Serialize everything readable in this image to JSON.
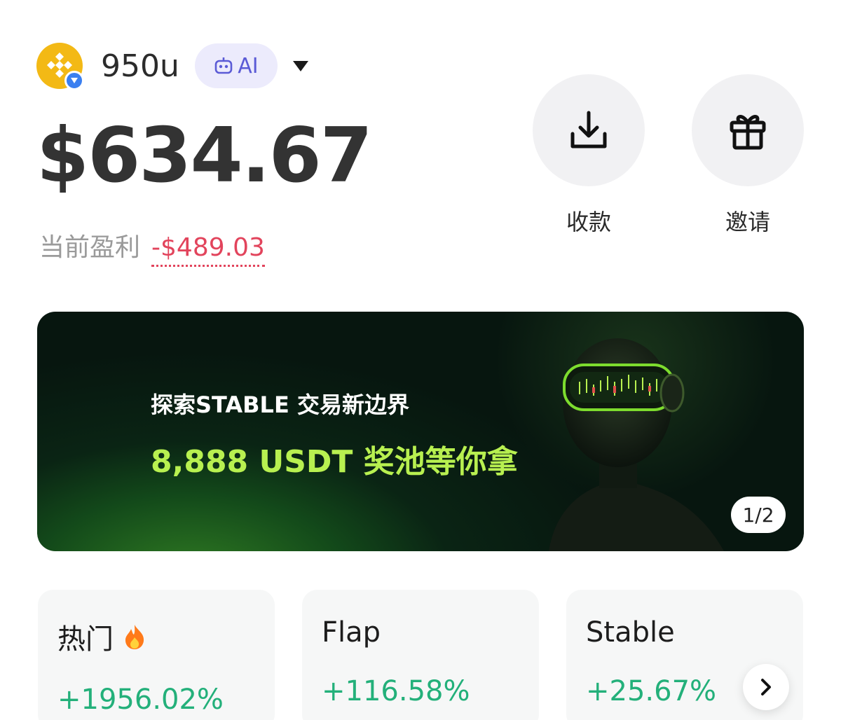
{
  "header": {
    "account_name": "950u",
    "ai_label": "AI"
  },
  "balance": {
    "amount": "$634.67",
    "pnl_label": "当前盈利",
    "pnl_value": "-$489.03"
  },
  "actions": [
    {
      "label": "收款",
      "icon": "download-icon"
    },
    {
      "label": "邀请",
      "icon": "gift-icon"
    }
  ],
  "banner": {
    "line1": "探索STABLE 交易新边界",
    "line2": "8,888 USDT 奖池等你拿",
    "pager": "1/2"
  },
  "cards": [
    {
      "title": "热门",
      "change": "+1956.02%",
      "icon": "fire-icon"
    },
    {
      "title": "Flap",
      "change": "+116.58%"
    },
    {
      "title": "Stable",
      "change": "+25.67%"
    }
  ],
  "colors": {
    "negative": "#e2445c",
    "positive": "#23b07a",
    "banner_highlight": "#b8f050",
    "ai_accent": "#5b5bd6"
  }
}
